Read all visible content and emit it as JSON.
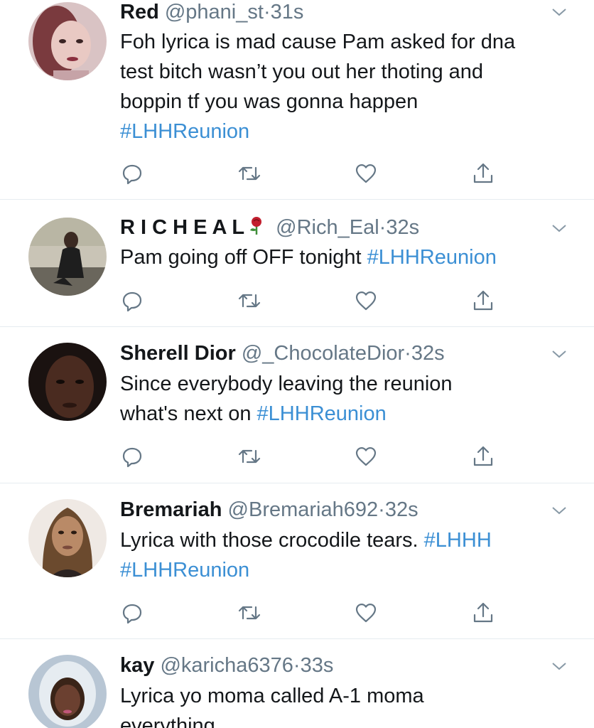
{
  "colors": {
    "text": "#14171a",
    "muted": "#657786",
    "link": "#3b8fd4",
    "divider": "#e6ecf0"
  },
  "tweets": [
    {
      "name": "Red",
      "handle": "@phani_st",
      "dot": "·",
      "time": "31s",
      "text": [
        "Foh lyrica is mad cause Pam asked for dna",
        "test bitch wasn’t you out her thoting and",
        "boppin tf you was gonna happen"
      ],
      "hashtag": "#LHHReunion",
      "avatar": "avatar-photo"
    },
    {
      "name": "R I C H E A L",
      "handle": "@Rich_Eal",
      "dot": "·",
      "time": "32s",
      "text": [
        "Pam going off OFF tonight "
      ],
      "hashtag": "#LHHReunion",
      "name_icon": "rose-emoji-icon",
      "avatar": "avatar-photo"
    },
    {
      "name": "Sherell Dior",
      "handle": "@_ChocolateDior",
      "dot": "·",
      "time": "32s",
      "text": [
        "Since everybody leaving the reunion",
        "what's next on "
      ],
      "hashtag": "#LHHReunion",
      "avatar": "avatar-photo"
    },
    {
      "name": "Bremariah",
      "handle": "@Bremariah692",
      "dot": "·",
      "time": "32s",
      "text": [
        "Lyrica with those crocodile tears. "
      ],
      "hashtag_inline": "#LHHH",
      "hashtag": "#LHHReunion",
      "avatar": "avatar-photo"
    },
    {
      "name": "kay",
      "handle": "@karicha6376",
      "dot": "·",
      "time": "33s",
      "text": [
        "Lyrica yo moma called A-1 moma",
        "everything"
      ],
      "avatar": "avatar-photo"
    }
  ],
  "icons": {
    "reply": "reply-icon",
    "retweet": "retweet-icon",
    "like": "heart-icon",
    "share": "share-icon",
    "caret": "chevron-down-icon"
  }
}
